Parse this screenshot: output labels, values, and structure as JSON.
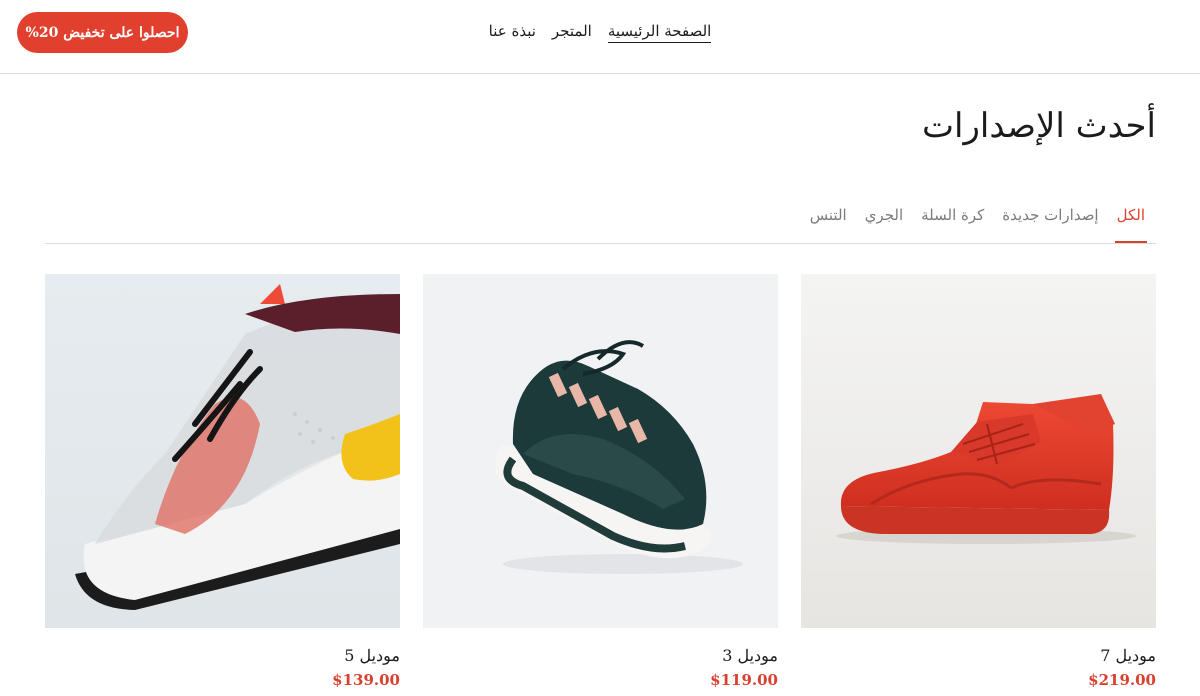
{
  "header": {
    "nav": [
      {
        "label": "الصفحة الرئيسية",
        "active": true
      },
      {
        "label": "المتجر",
        "active": false
      },
      {
        "label": "نبذة عنا",
        "active": false
      }
    ],
    "promo_label": "احصلوا على تخفيض 20%"
  },
  "main": {
    "title": "أحدث الإصدارات",
    "tabs": [
      {
        "label": "الكل",
        "active": true
      },
      {
        "label": "إصدارات جديدة",
        "active": false
      },
      {
        "label": "كرة السلة",
        "active": false
      },
      {
        "label": "الجري",
        "active": false
      },
      {
        "label": "التنس",
        "active": false
      }
    ],
    "products": [
      {
        "name": "موديل 7",
        "price": "$219.00",
        "image": "red-high-top-sneaker"
      },
      {
        "name": "موديل 3",
        "price": "$119.00",
        "image": "dark-green-running-sneaker"
      },
      {
        "name": "موديل 5",
        "price": "$139.00",
        "image": "white-sneaker-yellow-accent"
      }
    ]
  },
  "colors": {
    "accent": "#d9402f",
    "promo_bg": "#e0402d",
    "divider": "#dcdcdc"
  }
}
